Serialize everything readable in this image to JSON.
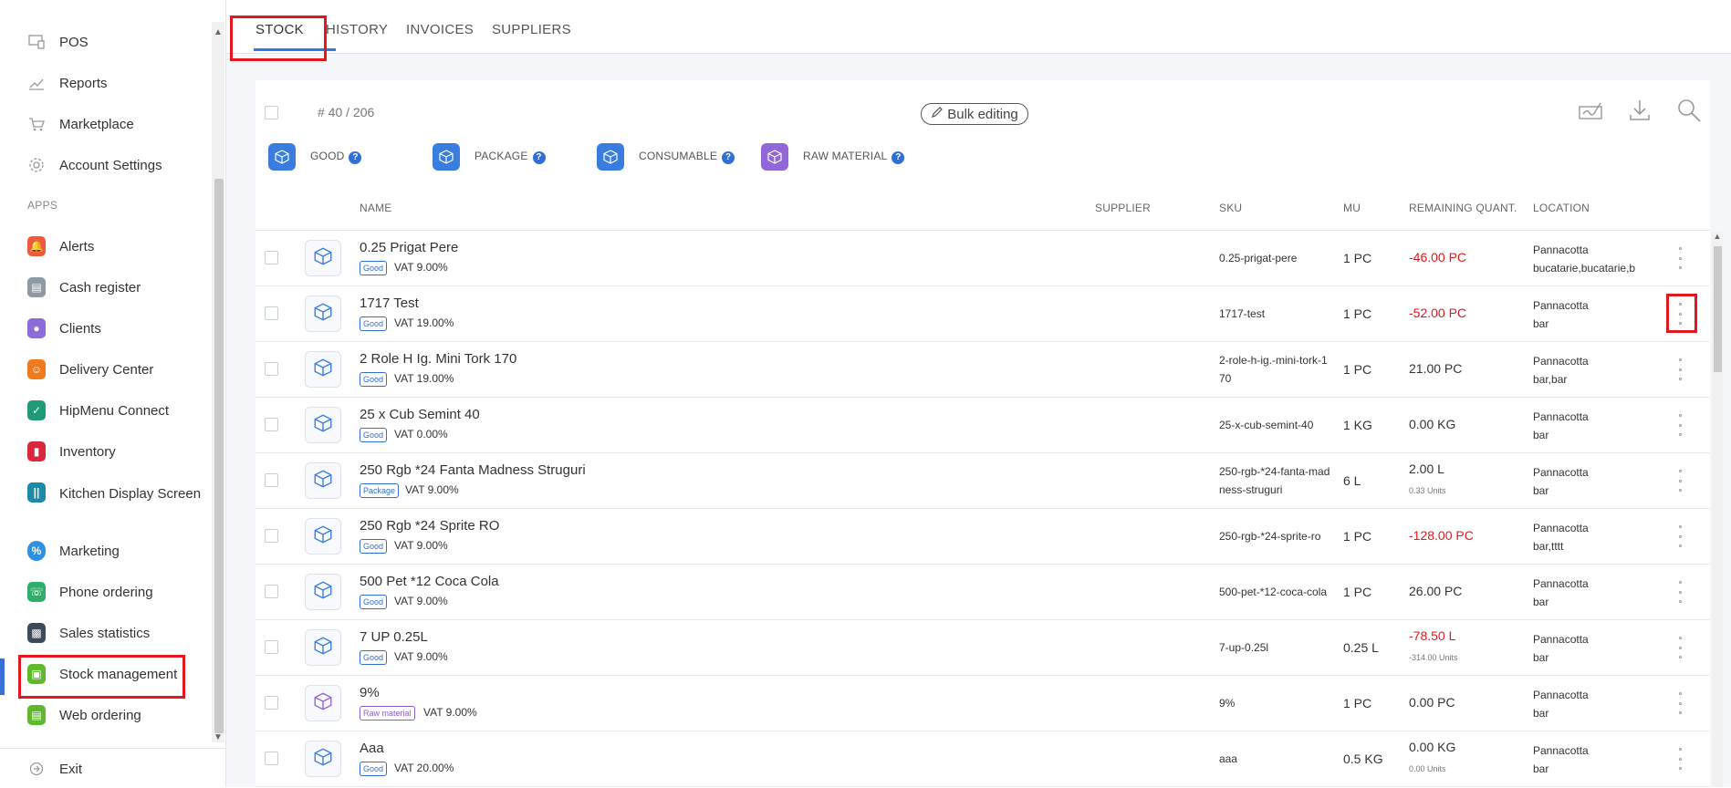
{
  "sidebar": {
    "top_items": [
      {
        "label": "POS",
        "icon": "pos-icon"
      },
      {
        "label": "Reports",
        "icon": "reports-icon"
      },
      {
        "label": "Marketplace",
        "icon": "cart-icon"
      },
      {
        "label": "Account Settings",
        "icon": "gear-icon"
      }
    ],
    "section_label": "APPS",
    "apps": [
      {
        "label": "Alerts",
        "icon": "alerts-icon",
        "color": "#f05a3c"
      },
      {
        "label": "Cash register",
        "icon": "cash-register-icon",
        "color": "#8f9aa5"
      },
      {
        "label": "Clients",
        "icon": "clients-icon",
        "color": "#8b6cd9"
      },
      {
        "label": "Delivery Center",
        "icon": "delivery-icon",
        "color": "#f07a1e"
      },
      {
        "label": "HipMenu Connect",
        "icon": "hipmenu-icon",
        "color": "#1f9b7a"
      },
      {
        "label": "Inventory",
        "icon": "inventory-icon",
        "color": "#d9283c"
      },
      {
        "label": "Kitchen Display Screen",
        "icon": "kitchen-icon",
        "color": "#1e8aa8"
      },
      {
        "label": "Marketing",
        "icon": "marketing-icon",
        "color": "#2f8fe0"
      },
      {
        "label": "Phone ordering",
        "icon": "phone-icon",
        "color": "#2fae6a"
      },
      {
        "label": "Sales statistics",
        "icon": "stats-icon",
        "color": "#3d4a5a"
      },
      {
        "label": "Stock management",
        "icon": "stock-icon",
        "color": "#5fb82e"
      },
      {
        "label": "Web ordering",
        "icon": "web-icon",
        "color": "#5fb82e"
      }
    ],
    "exit_label": "Exit"
  },
  "tabs": [
    "STOCK",
    "HISTORY",
    "INVOICES",
    "SUPPLIERS"
  ],
  "toolbar": {
    "count": "# 40 / 206",
    "bulk_label": "Bulk editing"
  },
  "types": [
    {
      "label": "GOOD",
      "color": "#3a7de0"
    },
    {
      "label": "PACKAGE",
      "color": "#3a7de0"
    },
    {
      "label": "CONSUMABLE",
      "color": "#3a7de0"
    },
    {
      "label": "RAW MATERIAL",
      "color": "#9066d8"
    }
  ],
  "columns": {
    "name": "NAME",
    "supplier": "SUPPLIER",
    "sku": "SKU",
    "mu": "MU",
    "remaining": "REMAINING QUANT.",
    "location": "LOCATION"
  },
  "colors": {
    "accent": "#2e7be4",
    "negative": "#e3171d",
    "highlight": "#e3171d"
  },
  "rows": [
    {
      "name": "0.25 Prigat Pere",
      "badge": "Good",
      "vat": "VAT 9.00%",
      "sku": "0.25-prigat-pere",
      "mu": "1 PC",
      "remaining": "-46.00 PC",
      "remaining_sub": "",
      "negative": true,
      "loc1": "Pannacotta",
      "loc2": "bucatarie,bucatarie,b"
    },
    {
      "name": "1717 Test",
      "badge": "Good",
      "vat": "VAT 19.00%",
      "sku": "1717-test",
      "mu": "1 PC",
      "remaining": "-52.00 PC",
      "remaining_sub": "",
      "negative": true,
      "loc1": "Pannacotta",
      "loc2": "bar"
    },
    {
      "name": "2 Role H Ig. Mini Tork 170",
      "badge": "Good",
      "vat": "VAT 19.00%",
      "sku": "2-role-h-ig.-mini-tork-170",
      "mu": "1 PC",
      "remaining": "21.00 PC",
      "remaining_sub": "",
      "negative": false,
      "loc1": "Pannacotta",
      "loc2": "bar,bar"
    },
    {
      "name": "25 x Cub Semint 40",
      "badge": "Good",
      "vat": "VAT 0.00%",
      "sku": "25-x-cub-semint-40",
      "mu": "1 KG",
      "remaining": "0.00 KG",
      "remaining_sub": "",
      "negative": false,
      "loc1": "Pannacotta",
      "loc2": "bar"
    },
    {
      "name": "250 Rgb *24 Fanta Madness Struguri",
      "badge": "Package",
      "vat": "VAT 9.00%",
      "sku": "250-rgb-*24-fanta-madness-struguri",
      "mu": "6 L",
      "remaining": "2.00 L",
      "remaining_sub": "0.33 Units",
      "negative": false,
      "loc1": "Pannacotta",
      "loc2": "bar"
    },
    {
      "name": "250 Rgb *24 Sprite RO",
      "badge": "Good",
      "vat": "VAT 9.00%",
      "sku": "250-rgb-*24-sprite-ro",
      "mu": "1 PC",
      "remaining": "-128.00 PC",
      "remaining_sub": "",
      "negative": true,
      "loc1": "Pannacotta",
      "loc2": "bar,tttt"
    },
    {
      "name": "500 Pet *12 Coca Cola",
      "badge": "Good",
      "vat": "VAT 9.00%",
      "sku": "500-pet-*12-coca-cola",
      "mu": "1 PC",
      "remaining": "26.00 PC",
      "remaining_sub": "",
      "negative": false,
      "loc1": "Pannacotta",
      "loc2": "bar"
    },
    {
      "name": "7 UP 0.25L",
      "badge": "Good",
      "vat": "VAT 9.00%",
      "sku": "7-up-0.25l",
      "mu": "0.25 L",
      "remaining": "-78.50 L",
      "remaining_sub": "-314.00 Units",
      "negative": true,
      "loc1": "Pannacotta",
      "loc2": "bar"
    },
    {
      "name": "9%",
      "badge": "Raw material",
      "vat": "VAT 9.00%",
      "sku": "9%",
      "mu": "1 PC",
      "remaining": "0.00 PC",
      "remaining_sub": "",
      "negative": false,
      "loc1": "Pannacotta",
      "loc2": "bar"
    },
    {
      "name": "Aaa",
      "badge": "Good",
      "vat": "VAT 20.00%",
      "sku": "aaa",
      "mu": "0.5 KG",
      "remaining": "0.00 KG",
      "remaining_sub": "0.00 Units",
      "negative": false,
      "loc1": "Pannacotta",
      "loc2": "bar"
    }
  ]
}
